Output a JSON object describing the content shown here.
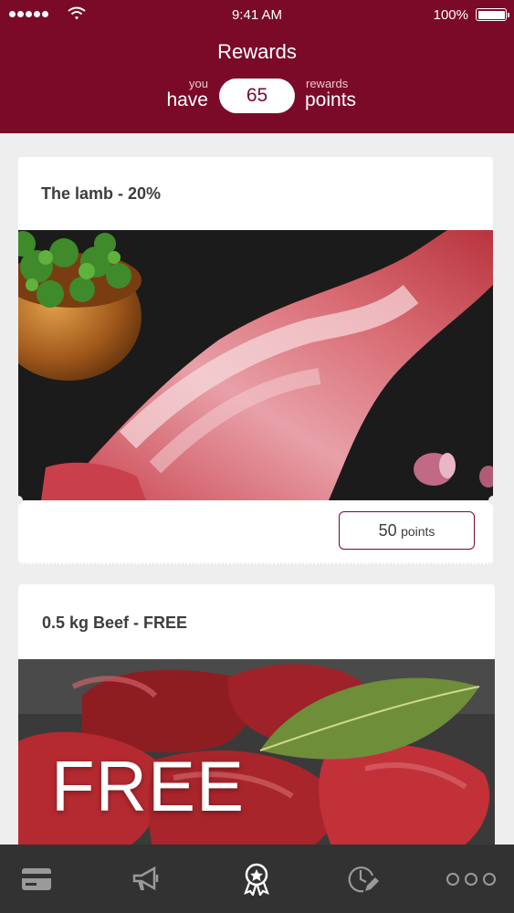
{
  "status_bar": {
    "time": "9:41 AM",
    "battery": "100%"
  },
  "header": {
    "title": "Rewards",
    "you_label": "you",
    "have_label": "have",
    "points_value": "65",
    "rewards_label": "rewards",
    "points_label": "points"
  },
  "rewards": [
    {
      "title": "The lamb - 20%",
      "points_value": "50",
      "points_unit": "points"
    },
    {
      "title": "0.5 kg Beef - FREE",
      "overlay_text": "FREE"
    }
  ],
  "tabbar": {
    "items": [
      {
        "icon": "card-icon",
        "active": false
      },
      {
        "icon": "megaphone-icon",
        "active": false
      },
      {
        "icon": "award-ribbon-icon",
        "active": true
      },
      {
        "icon": "clock-edit-icon",
        "active": false
      },
      {
        "icon": "more-icon",
        "active": false
      }
    ]
  },
  "colors": {
    "brand": "#7b0a29",
    "tabbar": "#323232",
    "background": "#efeeee"
  }
}
